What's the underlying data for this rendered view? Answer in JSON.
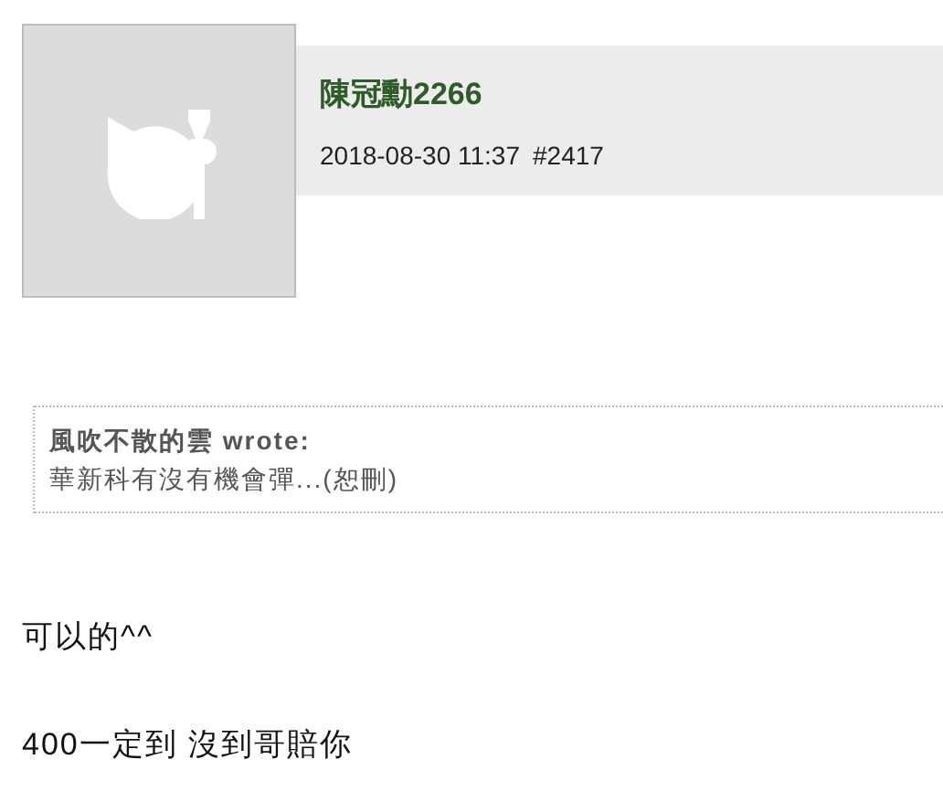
{
  "post": {
    "author": "陳冠勳2266",
    "timestamp": "2018-08-30 11:37",
    "post_number": "#2417"
  },
  "quote": {
    "author": "風吹不散的雲 wrote:",
    "text": "華新科有沒有機會彈...(恕刪)"
  },
  "body": [
    "可以的^^",
    "400一定到 沒到哥賠你"
  ]
}
